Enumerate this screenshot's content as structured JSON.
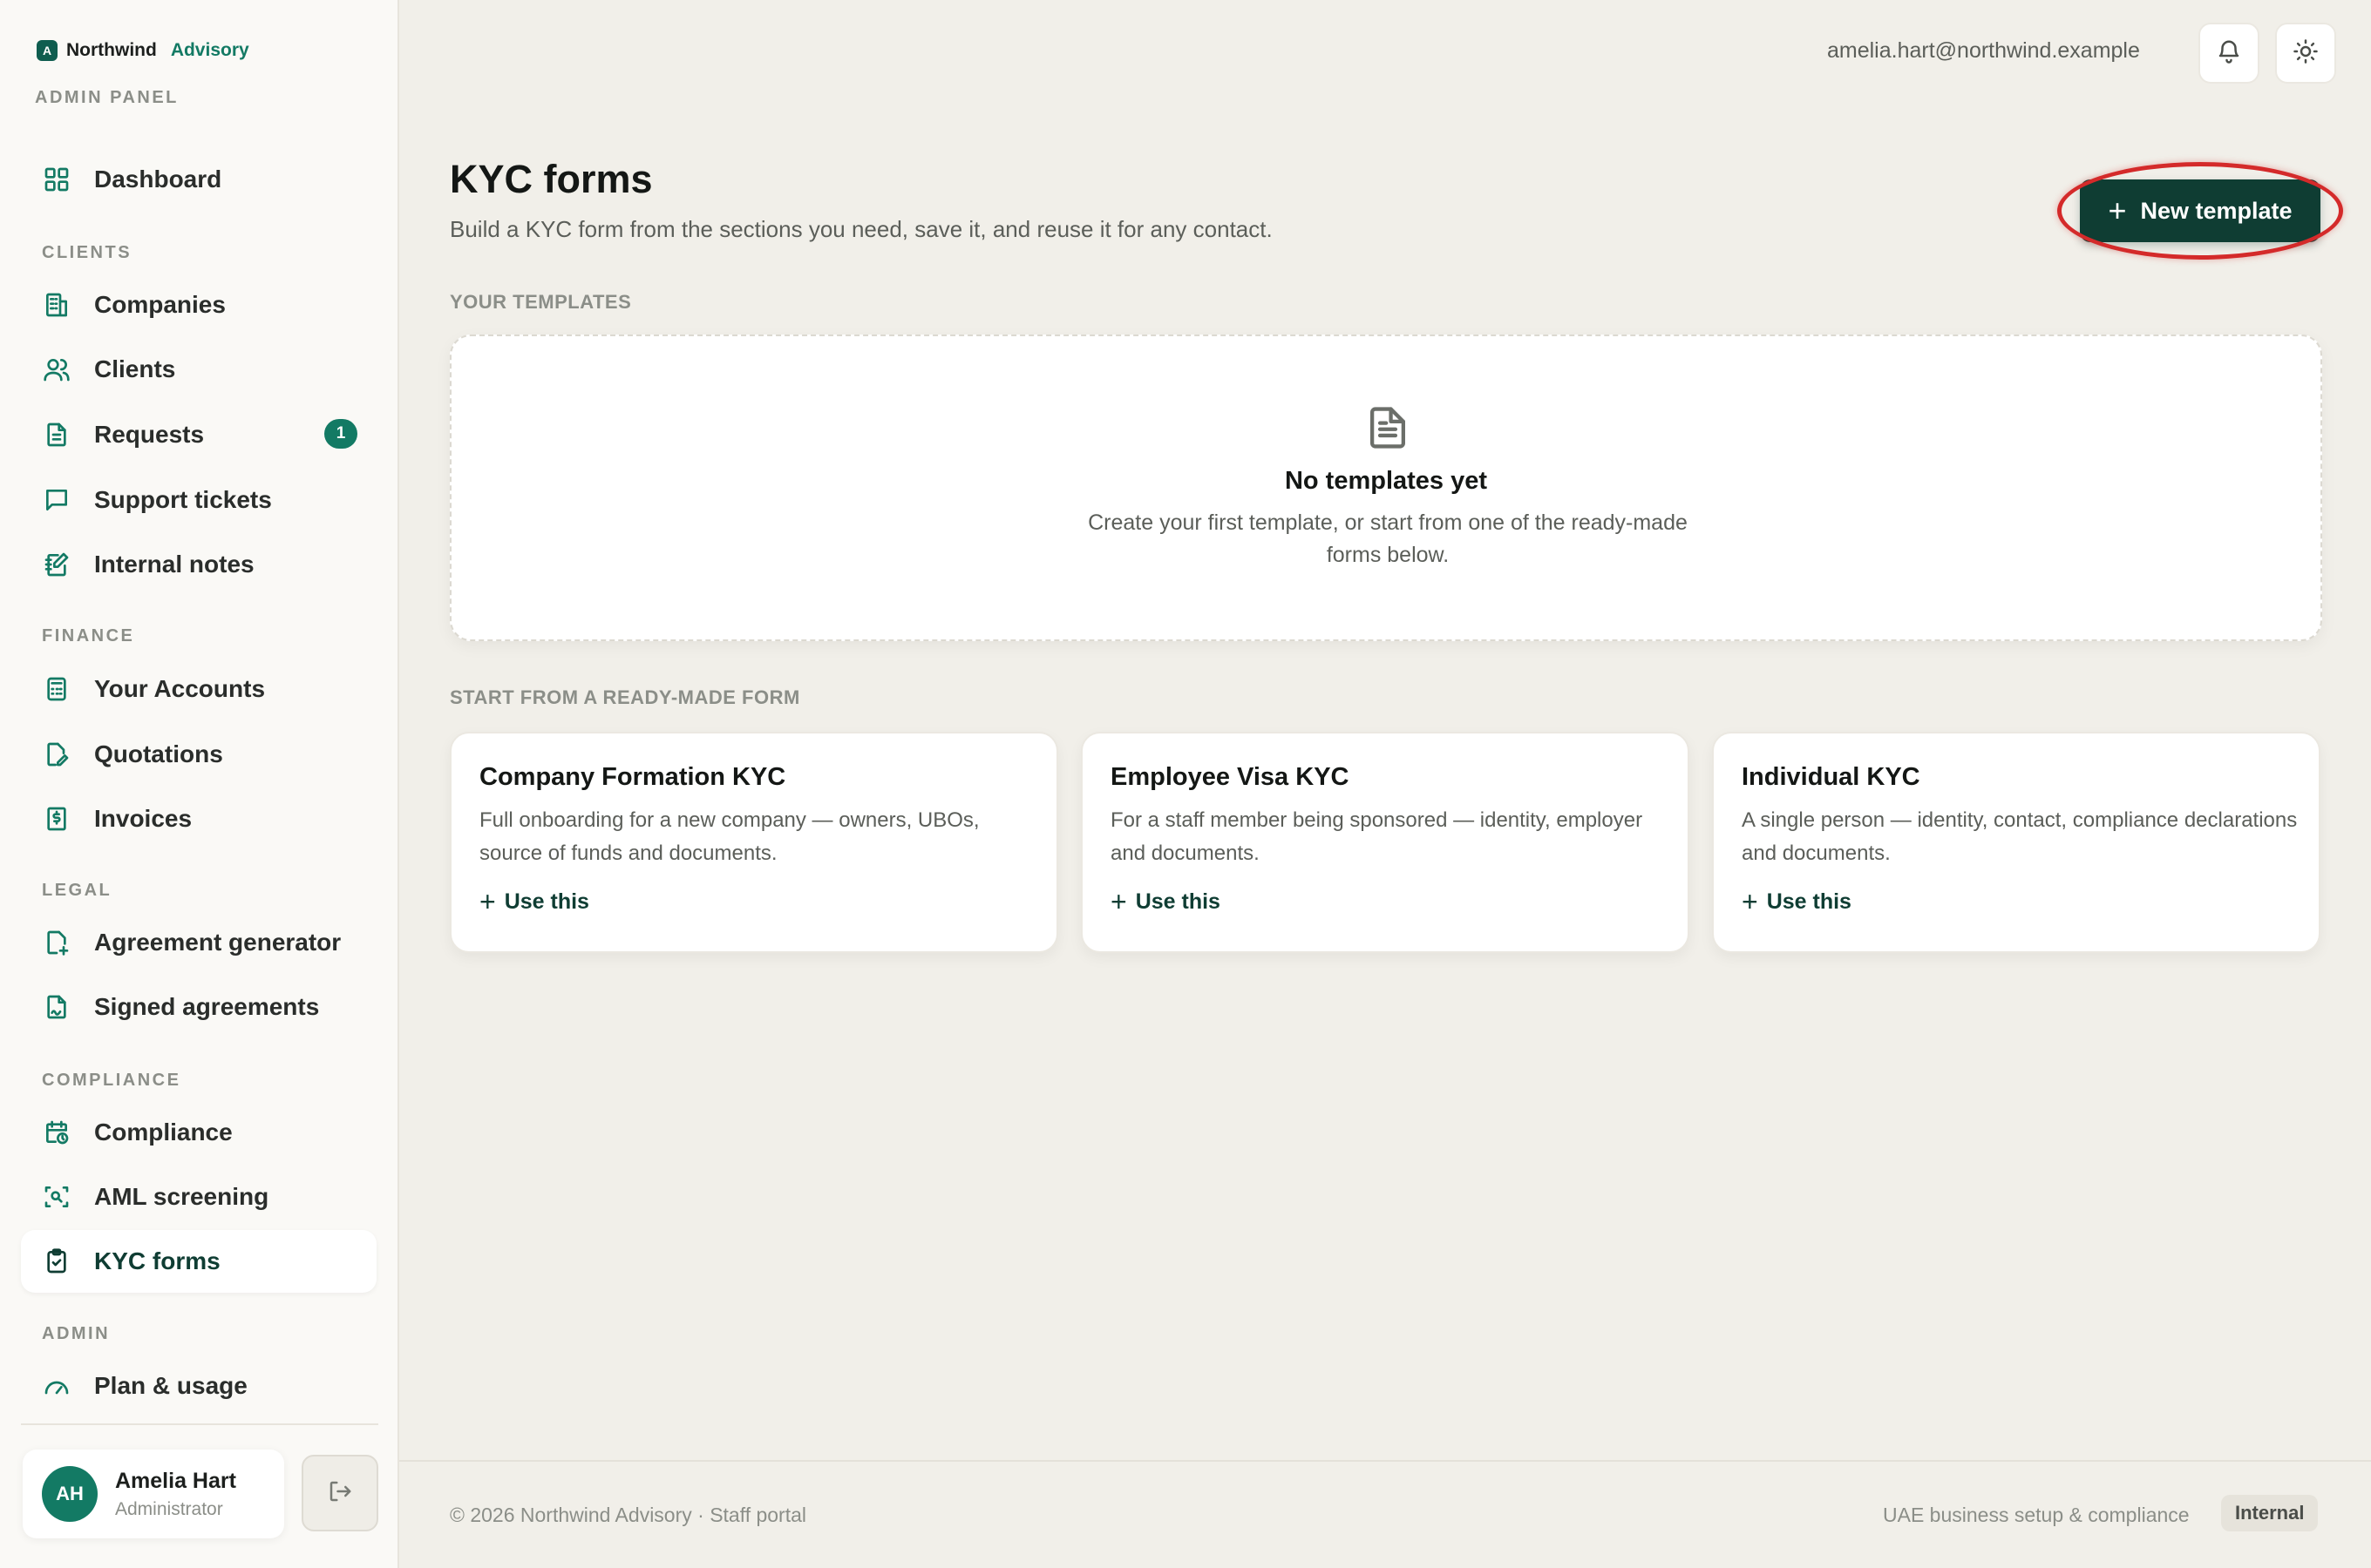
{
  "brand": {
    "mark": "A",
    "name": "Northwind",
    "sub": "Advisory",
    "panel_label": "ADMIN PANEL"
  },
  "nav": {
    "dashboard": "Dashboard",
    "clients_section": "CLIENTS",
    "companies": "Companies",
    "clients": "Clients",
    "requests": "Requests",
    "requests_badge": "1",
    "support_tickets": "Support tickets",
    "internal_notes": "Internal notes",
    "finance_section": "FINANCE",
    "your_accounts": "Your Accounts",
    "quotations": "Quotations",
    "invoices": "Invoices",
    "legal_section": "LEGAL",
    "agreement_generator": "Agreement generator",
    "signed_agreements": "Signed agreements",
    "compliance_section": "COMPLIANCE",
    "compliance": "Compliance",
    "aml_screening": "AML screening",
    "kyc_forms": "KYC forms",
    "admin_section": "ADMIN",
    "plan_usage": "Plan & usage"
  },
  "user": {
    "initials": "AH",
    "name": "Amelia Hart",
    "role": "Administrator",
    "email": "amelia.hart@northwind.example"
  },
  "page": {
    "title": "KYC forms",
    "subtitle": "Build a KYC form from the sections you need, save it, and reuse it for any contact.",
    "new_template_label": "New template",
    "templates_heading": "YOUR TEMPLATES",
    "empty_title": "No templates yet",
    "empty_text": "Create your first template, or start from one of the ready-made forms below.",
    "readymade_heading": "START FROM A READY-MADE FORM"
  },
  "forms": [
    {
      "title": "Company Formation KYC",
      "desc": "Full onboarding for a new company — owners, UBOs, source of funds and documents.",
      "action": "Use this"
    },
    {
      "title": "Employee Visa KYC",
      "desc": "For a staff member being sponsored — identity, employer and documents.",
      "action": "Use this"
    },
    {
      "title": "Individual KYC",
      "desc": "A single person — identity, contact, compliance declarations and documents.",
      "action": "Use this"
    }
  ],
  "footer": {
    "left": "© 2026 Northwind Advisory · Staff portal",
    "right": "UAE business setup & compliance",
    "tag": "Internal"
  },
  "colors": {
    "accent": "#137a64",
    "primary_dark": "#0f3d33",
    "highlight": "#d42a2a"
  }
}
